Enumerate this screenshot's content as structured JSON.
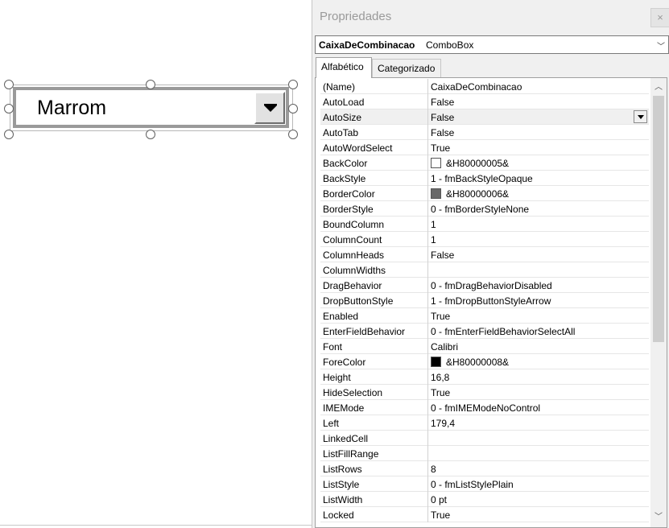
{
  "canvas": {
    "combo_value": "Marrom"
  },
  "window": {
    "title": "Propriedades",
    "close_label": "×"
  },
  "object_selector": {
    "name": "CaixaDeCombinacao",
    "type": "ComboBox",
    "chevron": "﹀"
  },
  "tabs": {
    "alphabetic": "Alfabético",
    "categorized": "Categorizado"
  },
  "colors": {
    "backcolor_swatch": "#ffffff",
    "bordercolor_swatch": "#696969",
    "forecolor_swatch": "#000000"
  },
  "properties": [
    {
      "name": "(Name)",
      "value": "CaixaDeCombinacao"
    },
    {
      "name": "AutoLoad",
      "value": "False"
    },
    {
      "name": "AutoSize",
      "value": "False"
    },
    {
      "name": "AutoTab",
      "value": "False"
    },
    {
      "name": "AutoWordSelect",
      "value": "True"
    },
    {
      "name": "BackColor",
      "value": "&H80000005&"
    },
    {
      "name": "BackStyle",
      "value": "1 - fmBackStyleOpaque"
    },
    {
      "name": "BorderColor",
      "value": "&H80000006&"
    },
    {
      "name": "BorderStyle",
      "value": "0 - fmBorderStyleNone"
    },
    {
      "name": "BoundColumn",
      "value": "1"
    },
    {
      "name": "ColumnCount",
      "value": "1"
    },
    {
      "name": "ColumnHeads",
      "value": "False"
    },
    {
      "name": "ColumnWidths",
      "value": ""
    },
    {
      "name": "DragBehavior",
      "value": "0 - fmDragBehaviorDisabled"
    },
    {
      "name": "DropButtonStyle",
      "value": "1 - fmDropButtonStyleArrow"
    },
    {
      "name": "Enabled",
      "value": "True"
    },
    {
      "name": "EnterFieldBehavior",
      "value": "0 - fmEnterFieldBehaviorSelectAll"
    },
    {
      "name": "Font",
      "value": "Calibri"
    },
    {
      "name": "ForeColor",
      "value": "&H80000008&"
    },
    {
      "name": "Height",
      "value": "16,8"
    },
    {
      "name": "HideSelection",
      "value": "True"
    },
    {
      "name": "IMEMode",
      "value": "0 - fmIMEModeNoControl"
    },
    {
      "name": "Left",
      "value": "179,4"
    },
    {
      "name": "LinkedCell",
      "value": ""
    },
    {
      "name": "ListFillRange",
      "value": ""
    },
    {
      "name": "ListRows",
      "value": "8"
    },
    {
      "name": "ListStyle",
      "value": "0 - fmListStylePlain"
    },
    {
      "name": "ListWidth",
      "value": "0 pt"
    },
    {
      "name": "Locked",
      "value": "True"
    }
  ]
}
